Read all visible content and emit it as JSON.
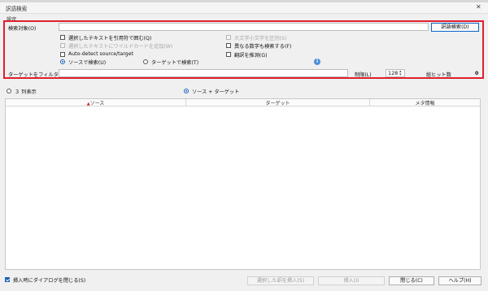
{
  "window": {
    "title": "訳語検索",
    "close_glyph": "✕"
  },
  "settings_group": {
    "label": "設定"
  },
  "search": {
    "label": "検索対象(O)",
    "value": "",
    "search_button": "訳語検索(D)"
  },
  "options": {
    "quote_selected": "選択したテキストを引用符で囲む(Q)",
    "wildcard_selected": "選択したテキストにワイルドカードを追加(W)",
    "auto_detect": "Auto-detect source/target",
    "case_sensitive": "大文字小文字を区別(S)",
    "different_numbers": "異なる数字も検索する(F)",
    "guess_translation": "翻訳を推測(G)"
  },
  "search_mode": {
    "source": "ソースで検索(U)",
    "target": "ターゲットで検索(T)",
    "selected": "source"
  },
  "filter": {
    "label": "ターゲットをフィルタ(F)",
    "value": "",
    "limit_label": "制限(L)",
    "limit_value": "128",
    "total_hits_label": "総ヒット数",
    "total_hits_value": "0"
  },
  "view_mode": {
    "three_columns": "３ 列表示",
    "source_target": "ソース + ターゲット",
    "selected": "source_target"
  },
  "table": {
    "columns": [
      "ソース",
      "ターゲット",
      "メタ情報"
    ],
    "sort_glyph": "▲",
    "rows": []
  },
  "footer": {
    "close_after_insert": "挿入時にダイアログを閉じる(S)",
    "insert_selected": "選択した訳を挿入(S)",
    "insert": "挿入(I)",
    "close": "閉じる(C)",
    "help": "ヘルプ(H)"
  }
}
